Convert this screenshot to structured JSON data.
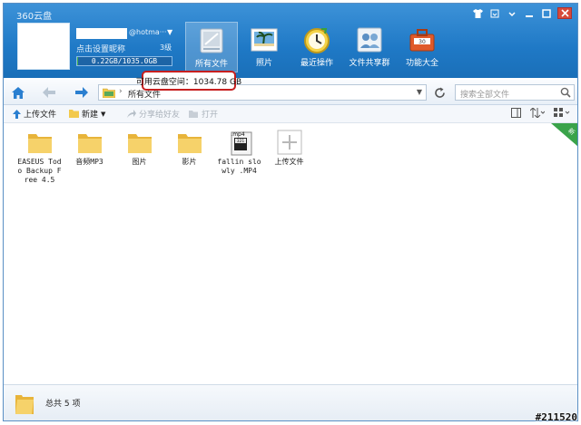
{
  "window": {
    "title": "360云盘"
  },
  "window_controls": [
    "shirt-icon",
    "menu-icon",
    "restore-icon",
    "minimize-icon",
    "maximize-icon",
    "close-icon"
  ],
  "account": {
    "email_suffix": "@hotma···",
    "nickname_prompt": "点击设置昵称",
    "level": "3级",
    "quota_text": "0.22GB/1035.0GB",
    "quota_used_fraction": 0.0002
  },
  "nav": {
    "items": [
      {
        "label": "所有文件",
        "icon": "all-files-icon",
        "active": true
      },
      {
        "label": "照片",
        "icon": "photos-icon",
        "active": false
      },
      {
        "label": "最近操作",
        "icon": "clock-icon",
        "active": false
      },
      {
        "label": "文件共享群",
        "icon": "share-group-icon",
        "active": false
      },
      {
        "label": "功能大全",
        "icon": "toolbox-icon",
        "active": false
      }
    ]
  },
  "callout": {
    "text": "可用云盘空间：1034.78 GB"
  },
  "address": {
    "path": "所有文件",
    "search_placeholder": "搜索全部文件"
  },
  "toolbar": {
    "upload": "上传文件",
    "new": "新建",
    "share": "分享给好友",
    "open": "打开"
  },
  "ribbon": {
    "text": "新"
  },
  "files": [
    {
      "name": "EASEUS Todo Backup Free 4.5",
      "type": "folder"
    },
    {
      "name": "音频MP3",
      "type": "folder"
    },
    {
      "name": "图片",
      "type": "folder"
    },
    {
      "name": "影片",
      "type": "folder"
    },
    {
      "name": "fallin slowly .MP4",
      "type": "mp4",
      "badge": ".mp4"
    },
    {
      "name": "上传文件",
      "type": "upload"
    }
  ],
  "status": {
    "count": "总共 5 项"
  },
  "watermark": "#211520",
  "colors": {
    "header": "#1f79c6",
    "callout_border": "#c61f1f",
    "folder": "#f2c94c"
  }
}
